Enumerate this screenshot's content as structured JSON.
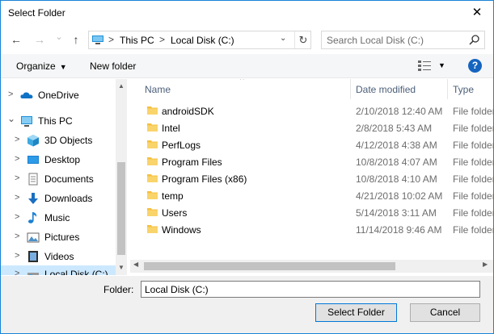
{
  "window": {
    "title": "Select Folder",
    "close_glyph": "✕"
  },
  "nav": {
    "back_glyph": "←",
    "forward_glyph": "→",
    "recent_glyph": "⌄",
    "up_glyph": "↑",
    "breadcrumb": [
      "This PC",
      "Local Disk (C:)"
    ],
    "separator": ">",
    "dropdown_glyph": "⌄",
    "refresh_glyph": "↻",
    "search_placeholder": "Search Local Disk (C:)"
  },
  "toolbar": {
    "organize_label": "Organize",
    "organize_arrow": "▼",
    "new_folder_label": "New folder",
    "view_arrow": "▼",
    "help_label": "?"
  },
  "navpane": {
    "items": [
      {
        "label": "OneDrive",
        "chevron": ">",
        "icon": "cloud-icon"
      },
      {
        "label": "This PC",
        "chevron": "⌄",
        "icon": "computer-icon"
      },
      {
        "label": "3D Objects",
        "chevron": ">",
        "icon": "cube-icon"
      },
      {
        "label": "Desktop",
        "chevron": ">",
        "icon": "desktop-icon"
      },
      {
        "label": "Documents",
        "chevron": ">",
        "icon": "document-icon"
      },
      {
        "label": "Downloads",
        "chevron": ">",
        "icon": "download-icon"
      },
      {
        "label": "Music",
        "chevron": ">",
        "icon": "music-icon"
      },
      {
        "label": "Pictures",
        "chevron": ">",
        "icon": "picture-icon"
      },
      {
        "label": "Videos",
        "chevron": ">",
        "icon": "video-icon"
      },
      {
        "label": "Local Disk (C:)",
        "chevron": ">",
        "icon": "drive-icon"
      }
    ],
    "scroll_up": "▲",
    "scroll_down": "▼"
  },
  "filelist": {
    "columns": {
      "name": "Name",
      "date": "Date modified",
      "type": "Type"
    },
    "sort_glyph": "^",
    "rows": [
      {
        "name": "androidSDK",
        "date": "2/10/2018 12:40 AM",
        "type": "File folder"
      },
      {
        "name": "Intel",
        "date": "2/8/2018 5:43 AM",
        "type": "File folder"
      },
      {
        "name": "PerfLogs",
        "date": "4/12/2018 4:38 AM",
        "type": "File folder"
      },
      {
        "name": "Program Files",
        "date": "10/8/2018 4:07 AM",
        "type": "File folder"
      },
      {
        "name": "Program Files (x86)",
        "date": "10/8/2018 4:10 AM",
        "type": "File folder"
      },
      {
        "name": "temp",
        "date": "4/21/2018 10:02 AM",
        "type": "File folder"
      },
      {
        "name": "Users",
        "date": "5/14/2018 3:11 AM",
        "type": "File folder"
      },
      {
        "name": "Windows",
        "date": "11/14/2018 9:46 AM",
        "type": "File folder"
      }
    ],
    "scroll_left": "◀",
    "scroll_right": "▶"
  },
  "footer": {
    "folder_label": "Folder:",
    "folder_value": "Local Disk (C:)",
    "select_label": "Select Folder",
    "cancel_label": "Cancel"
  },
  "colors": {
    "accent": "#0078d7",
    "folder": "#f5c040",
    "selection": "#cce8ff",
    "help": "#1565c0"
  }
}
